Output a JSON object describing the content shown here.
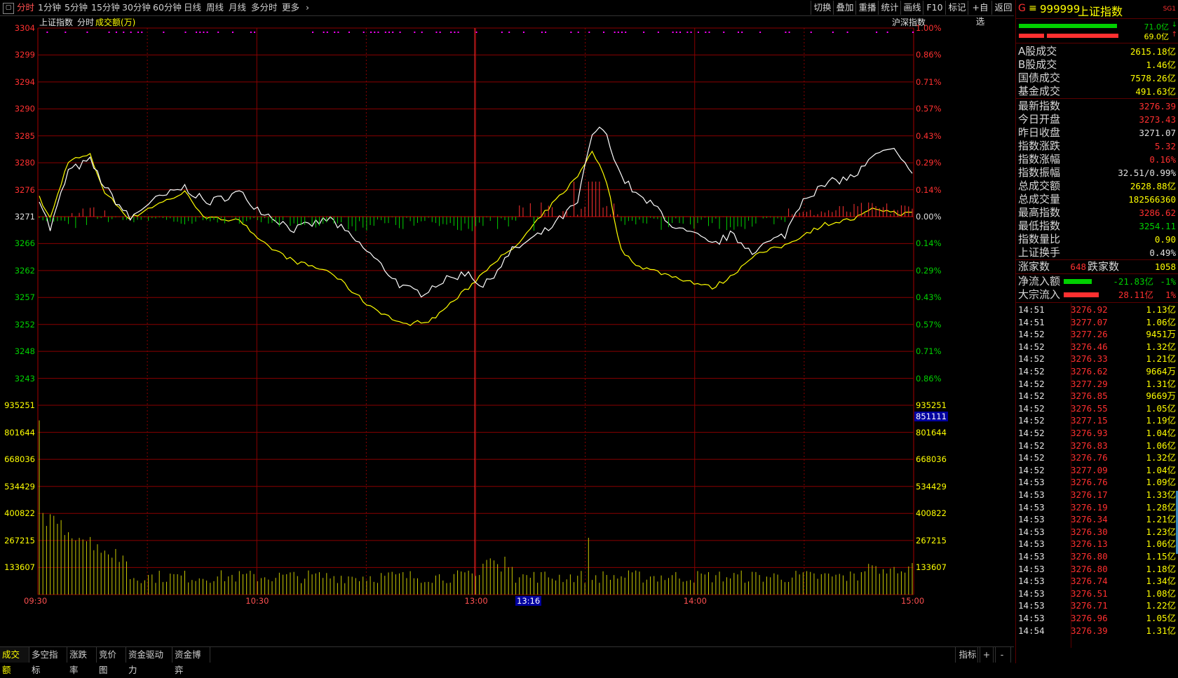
{
  "toolbar": {
    "menu_icon": "window-icon",
    "tabs": [
      "分时",
      "1分钟",
      "5分钟",
      "15分钟",
      "30分钟",
      "60分钟",
      "日线",
      "周线",
      "月线",
      "多分时",
      "更多"
    ],
    "selected": "分时",
    "right_buttons": [
      "切换",
      "叠加",
      "重播",
      "统计",
      "画线",
      "F10",
      "标记",
      "+自选",
      "返回"
    ]
  },
  "chart_header": {
    "name": "上证指数",
    "mode": "分时",
    "volume_label": "成交额(万)",
    "compare_label": "沪深指数"
  },
  "axes": {
    "price_ticks": [
      "3304",
      "3299",
      "3294",
      "3290",
      "3285",
      "3280",
      "3276",
      "3271",
      "3266",
      "3262",
      "3257",
      "3252",
      "3248",
      "3243"
    ],
    "pct_ticks": [
      "1.00%",
      "0.86%",
      "0.71%",
      "0.57%",
      "0.43%",
      "0.29%",
      "0.14%",
      "0.00%",
      "0.14%",
      "0.29%",
      "0.43%",
      "0.57%",
      "0.71%",
      "0.86%"
    ],
    "volume_ticks": [
      "935251",
      "801644",
      "668036",
      "534429",
      "400822",
      "267215",
      "133607"
    ],
    "volume_cursor": "851111",
    "time_ticks": [
      "09:30",
      "10:30",
      "13:00",
      "14:00",
      "15:00"
    ],
    "cursor_time": "13:16"
  },
  "colors": {
    "up": "#ff3030",
    "down": "#00d000",
    "white_line": "#ffffff",
    "yellow_line": "#ffff00",
    "grid": "#8a0000",
    "volume": "#c8c800",
    "marker": "#ff00ff"
  },
  "chart_data": {
    "type": "line",
    "series": [],
    "x": [
      "09:30",
      "10:30",
      "13:00",
      "14:00",
      "15:00"
    ],
    "ylim": [
      3243,
      3304
    ],
    "prev_close": 3271.07,
    "volume_ylim": [
      0,
      935251
    ]
  },
  "right_panel": {
    "header": {
      "g": "G",
      "code": "999999",
      "name": "上证指数",
      "tag": "SG1"
    },
    "bars": [
      {
        "value": "71.0亿",
        "dir": "down"
      },
      {
        "value": "69.0亿",
        "dir": "up"
      }
    ],
    "turnover": [
      {
        "k": "A股成交",
        "v": "2615.18亿"
      },
      {
        "k": "B股成交",
        "v": "1.46亿"
      },
      {
        "k": "国债成交",
        "v": "7578.26亿"
      },
      {
        "k": "基金成交",
        "v": "491.63亿"
      }
    ],
    "stats": [
      {
        "k": "最新指数",
        "v": "3276.39",
        "c": "up"
      },
      {
        "k": "今日开盘",
        "v": "3273.43",
        "c": "up"
      },
      {
        "k": "昨日收盘",
        "v": "3271.07",
        "c": "flat"
      },
      {
        "k": "指数涨跌",
        "v": "5.32",
        "c": "up"
      },
      {
        "k": "指数涨幅",
        "v": "0.16%",
        "c": "up"
      },
      {
        "k": "指数振幅",
        "v": "32.51/0.99%",
        "c": "flat"
      },
      {
        "k": "总成交额",
        "v": "2628.88亿",
        "c": "yellow"
      },
      {
        "k": "总成交量",
        "v": "182566360",
        "c": "yellow"
      },
      {
        "k": "最高指数",
        "v": "3286.62",
        "c": "up"
      },
      {
        "k": "最低指数",
        "v": "3254.11",
        "c": "down"
      },
      {
        "k": "指数量比",
        "v": "0.90",
        "c": "yellow"
      },
      {
        "k": "上证换手",
        "v": "0.49%",
        "c": "flat"
      }
    ],
    "breadth": {
      "up_label": "涨家数",
      "up": "648",
      "down_label": "跌家数",
      "down": "1058"
    },
    "flows": [
      {
        "k": "净流入额",
        "v": "-21.83亿",
        "pct": "-1%",
        "c": "down"
      },
      {
        "k": "大宗流入",
        "v": "28.11亿",
        "pct": "1%",
        "c": "up"
      }
    ],
    "ticks": [
      {
        "t": "14:51",
        "p": "3276.92",
        "a": "1.13亿"
      },
      {
        "t": "14:51",
        "p": "3277.07",
        "a": "1.06亿"
      },
      {
        "t": "14:52",
        "p": "3277.26",
        "a": "9451万"
      },
      {
        "t": "14:52",
        "p": "3276.46",
        "a": "1.32亿"
      },
      {
        "t": "14:52",
        "p": "3276.33",
        "a": "1.21亿"
      },
      {
        "t": "14:52",
        "p": "3276.62",
        "a": "9664万"
      },
      {
        "t": "14:52",
        "p": "3277.29",
        "a": "1.31亿"
      },
      {
        "t": "14:52",
        "p": "3276.85",
        "a": "9669万"
      },
      {
        "t": "14:52",
        "p": "3276.55",
        "a": "1.05亿"
      },
      {
        "t": "14:52",
        "p": "3277.15",
        "a": "1.19亿"
      },
      {
        "t": "14:52",
        "p": "3276.93",
        "a": "1.04亿"
      },
      {
        "t": "14:52",
        "p": "3276.83",
        "a": "1.06亿"
      },
      {
        "t": "14:52",
        "p": "3276.76",
        "a": "1.32亿"
      },
      {
        "t": "14:52",
        "p": "3277.09",
        "a": "1.04亿"
      },
      {
        "t": "14:53",
        "p": "3276.76",
        "a": "1.09亿"
      },
      {
        "t": "14:53",
        "p": "3276.17",
        "a": "1.33亿"
      },
      {
        "t": "14:53",
        "p": "3276.19",
        "a": "1.28亿"
      },
      {
        "t": "14:53",
        "p": "3276.34",
        "a": "1.21亿"
      },
      {
        "t": "14:53",
        "p": "3276.30",
        "a": "1.23亿"
      },
      {
        "t": "14:53",
        "p": "3276.13",
        "a": "1.06亿"
      },
      {
        "t": "14:53",
        "p": "3276.80",
        "a": "1.15亿"
      },
      {
        "t": "14:53",
        "p": "3276.80",
        "a": "1.18亿"
      },
      {
        "t": "14:53",
        "p": "3276.74",
        "a": "1.34亿"
      },
      {
        "t": "14:53",
        "p": "3276.51",
        "a": "1.08亿"
      },
      {
        "t": "14:53",
        "p": "3276.71",
        "a": "1.22亿"
      },
      {
        "t": "14:53",
        "p": "3276.96",
        "a": "1.05亿"
      },
      {
        "t": "14:54",
        "p": "3276.39",
        "a": "1.31亿"
      }
    ]
  },
  "bottom_tabs": {
    "items": [
      "成交额",
      "多空指标",
      "涨跌率",
      "竞价图",
      "资金驱动力",
      "资金博弈"
    ],
    "selected": "成交额",
    "right": [
      "指标",
      "+",
      "-"
    ]
  }
}
